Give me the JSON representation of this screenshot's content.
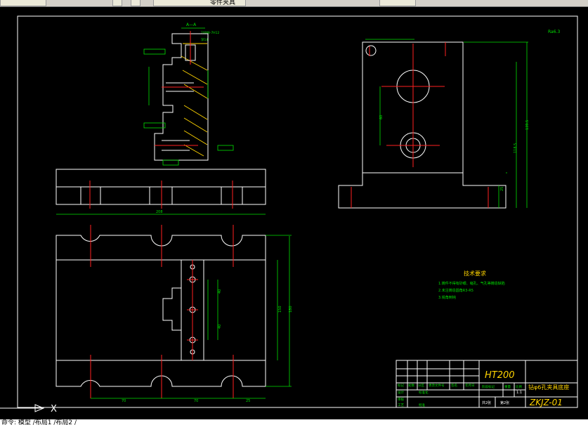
{
  "app": {
    "toolbar_fragment": "零件夹具",
    "command_line": "命令: 模型 /布局1 /布局2 /"
  },
  "drawing": {
    "section_label": "A—A",
    "section_dims": [
      "2XM8-7H12",
      "深14"
    ],
    "roughness_mark": "Ra6.3",
    "front_dims": {
      "overall_width": "208"
    },
    "side_dims": {
      "height_total": "139.5",
      "height_mid": "118.5",
      "base_h": "25",
      "hole_spacing": "60"
    },
    "plan_dims": {
      "d1": "70",
      "d2": "70",
      "d3": "25",
      "h1": "150",
      "h2": "180",
      "s1": "40",
      "s2": "40"
    },
    "tech_req": {
      "title": "技术要求",
      "items": [
        "1.铸件不得有砂眼、缩孔、气孔等铸造缺陷",
        "2.未注铸造圆角R3-R5",
        "3.锐角倒钝"
      ]
    },
    "title_block": {
      "material": "HT200",
      "part_name": "钻φ6孔夹具底座",
      "drawing_no": "ZKJZ-01",
      "scale": "1:1",
      "sheets_total": "共2张",
      "sheet_no": "第2张",
      "labels": {
        "mark": "标记",
        "count": "处数",
        "zone": "分区",
        "change_doc": "更改文件号",
        "sign": "签名",
        "date": "年月日",
        "design": "设计",
        "standard": "标准化",
        "review": "审核",
        "process": "工艺",
        "approve": "批准",
        "stage_mark": "阶段标记",
        "weight": "重量",
        "scale_label": "比例"
      }
    }
  },
  "ucs": {
    "x_axis": "X"
  }
}
